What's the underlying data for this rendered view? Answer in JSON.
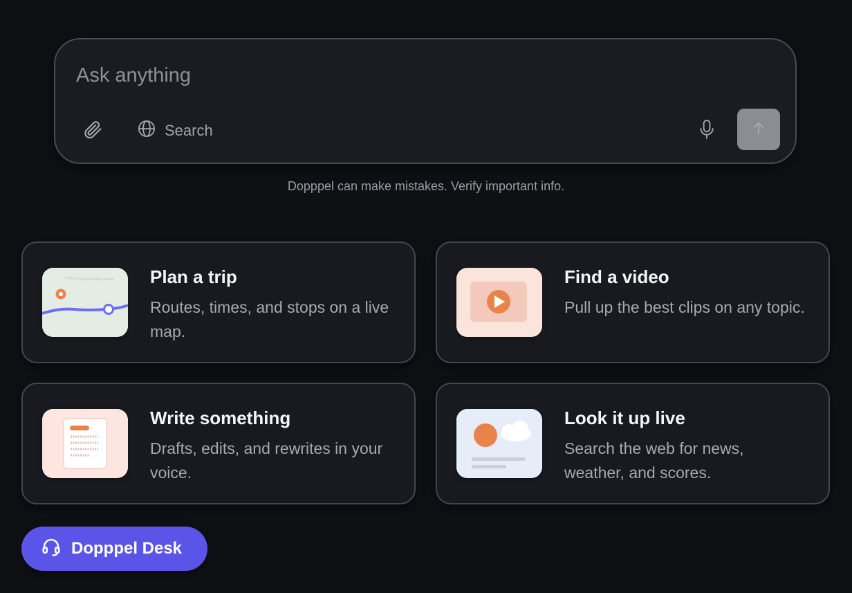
{
  "composer": {
    "placeholder": "Ask anything",
    "value": "",
    "search_label": "Search",
    "icons": {
      "attach": "paperclip-icon",
      "search": "globe-icon",
      "mic": "microphone-icon",
      "send": "arrow-up-icon"
    },
    "send_button_color": "#8c8d93"
  },
  "disclaimer": "Dopppel can make mistakes. Verify important info.",
  "cards": [
    {
      "title": "Plan a trip",
      "description": "Routes, times, and stops on a live map.",
      "icon": "map-thumbnail"
    },
    {
      "title": "Find a video",
      "description": "Pull up the best clips on any topic.",
      "icon": "video-play-thumbnail"
    },
    {
      "title": "Write something",
      "description": "Drafts, edits, and rewrites in your voice.",
      "icon": "document-thumbnail"
    },
    {
      "title": "Look it up live",
      "description": "Search the web for news, weather, and scores.",
      "icon": "weather-news-thumbnail"
    }
  ],
  "desk_button": {
    "label": "Dopppel Desk",
    "icon": "headset-icon",
    "color": "#5b54e8"
  },
  "colors": {
    "background": "#0f1014",
    "accent": "#e8834a",
    "map_route": "#6a6ef0"
  }
}
